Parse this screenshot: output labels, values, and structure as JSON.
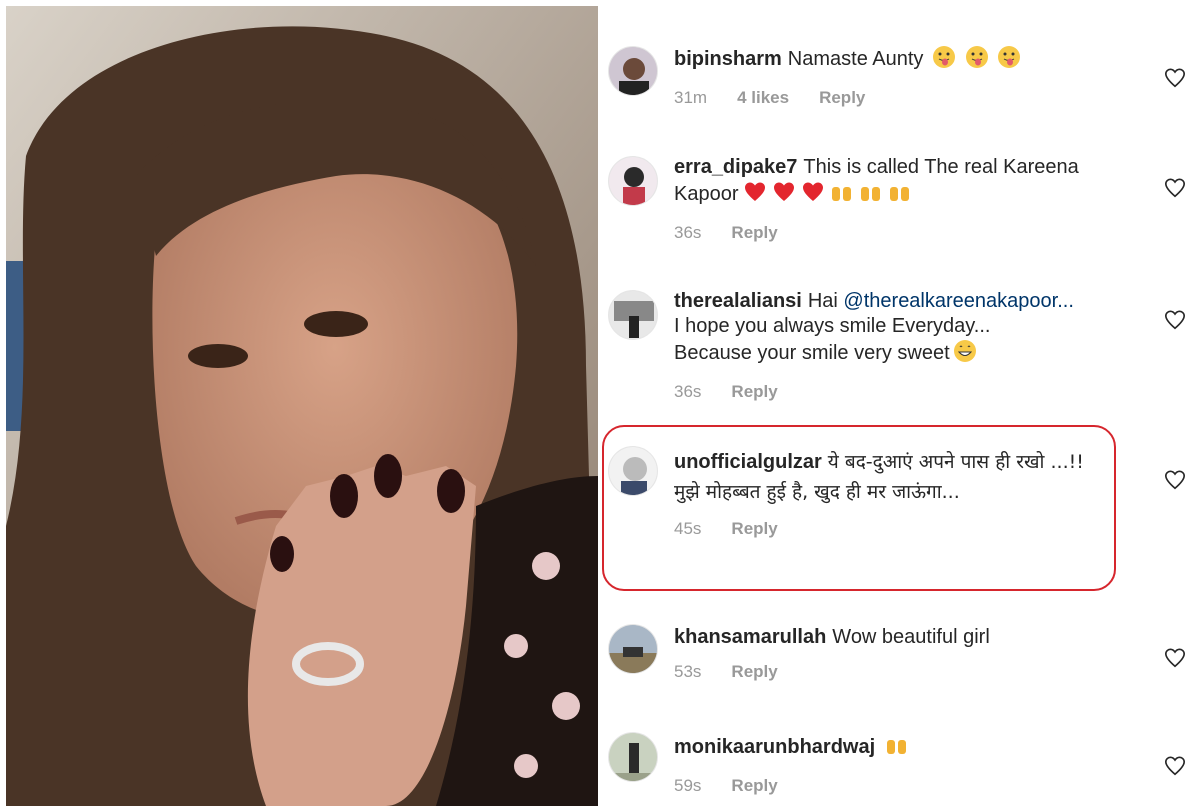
{
  "photo": {
    "description_icon": "selfie-photo"
  },
  "comments": [
    {
      "username": "bipinsharm",
      "text": "Namaste Aunty",
      "emoji": [
        "tongue-face",
        "tongue-face",
        "tongue-face"
      ],
      "time": "31m",
      "likes": "4 likes",
      "reply": "Reply"
    },
    {
      "username": "erra_dipake7",
      "text": "This is called The real Kareena Kapoor",
      "emoji": [
        "red-heart",
        "red-heart",
        "red-heart",
        "raised-hands",
        "raised-hands",
        "raised-hands"
      ],
      "time": "36s",
      "likes": "",
      "reply": "Reply"
    },
    {
      "username": "therealaliansi",
      "text": "Hai",
      "mention": "@therealkareenakapoor...",
      "line2": "I hope you always smile Everyday...",
      "line3": "Because your smile very sweet",
      "emoji": [
        "grin-face"
      ],
      "time": "36s",
      "likes": "",
      "reply": "Reply"
    },
    {
      "username": "unofficialgulzar",
      "text": "ये बद-दुआएं अपने पास ही रखो ...!!",
      "line2": "मुझे मोहब्बत हुई है, खुद ही मर जाऊंगा...",
      "time": "45s",
      "likes": "",
      "reply": "Reply"
    },
    {
      "username": "khansamarullah",
      "text": "Wow beautiful girl",
      "time": "53s",
      "likes": "",
      "reply": "Reply"
    },
    {
      "username": "monikaarunbhardwaj",
      "text": "",
      "emoji": [
        "raised-hands"
      ],
      "time": "59s",
      "likes": "",
      "reply": "Reply"
    }
  ],
  "colors": {
    "text": "#262626",
    "meta": "#999999",
    "highlight": "#d6262d",
    "mention": "#003569"
  }
}
